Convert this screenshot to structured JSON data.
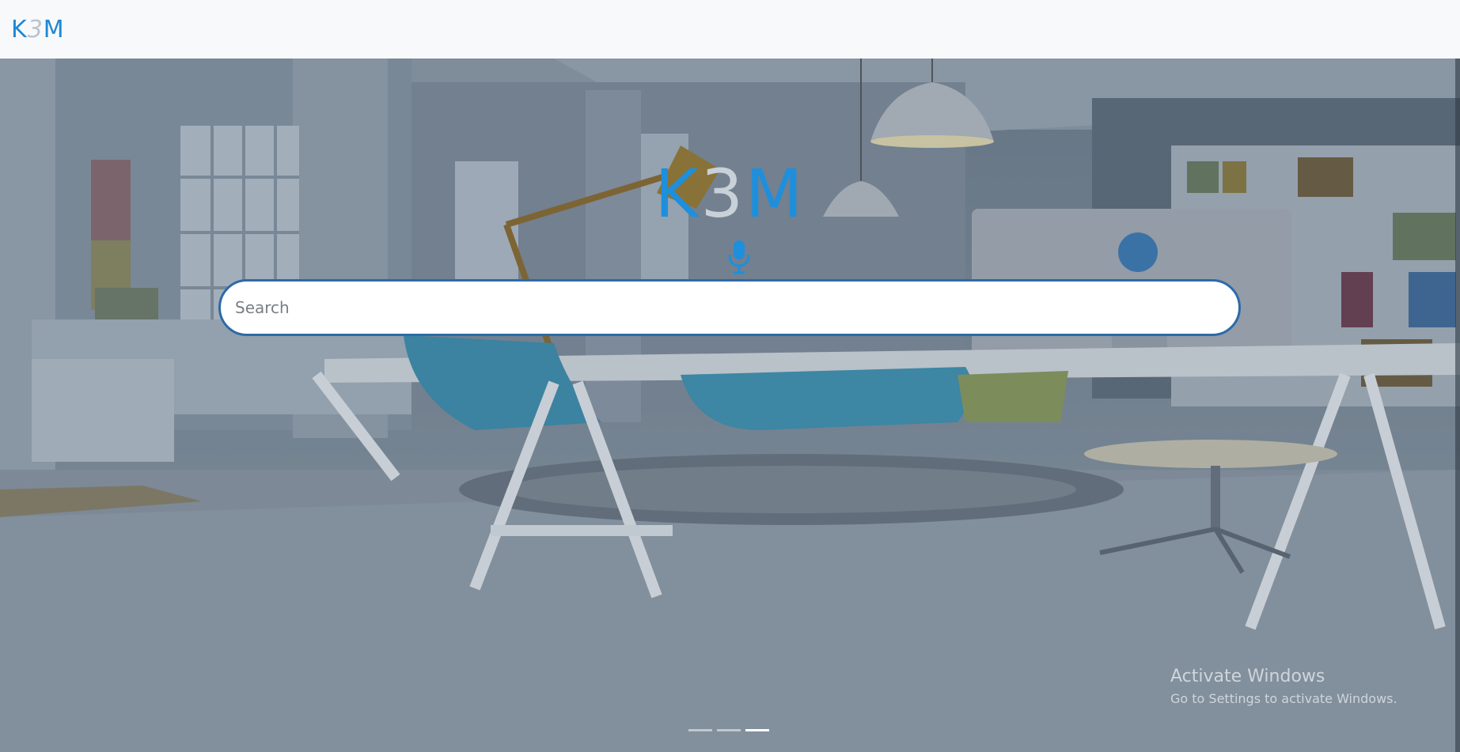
{
  "navbar": {
    "logo": {
      "k": "K",
      "three": "3",
      "m": "M"
    }
  },
  "hero": {
    "logo": {
      "k": "K",
      "three": "3",
      "m": "M"
    },
    "mic_icon": "microphone-icon",
    "search": {
      "placeholder": "Search",
      "value": ""
    },
    "carousel": {
      "slide_count": 3,
      "active_index": 2
    }
  },
  "watermark": {
    "title": "Activate Windows",
    "subtitle": "Go to Settings to activate Windows."
  },
  "colors": {
    "brand_blue": "#1e88d6",
    "logo_three": "#b9c4cf",
    "search_border": "#2d6aa8",
    "navbar_bg": "#f8f9fa"
  }
}
